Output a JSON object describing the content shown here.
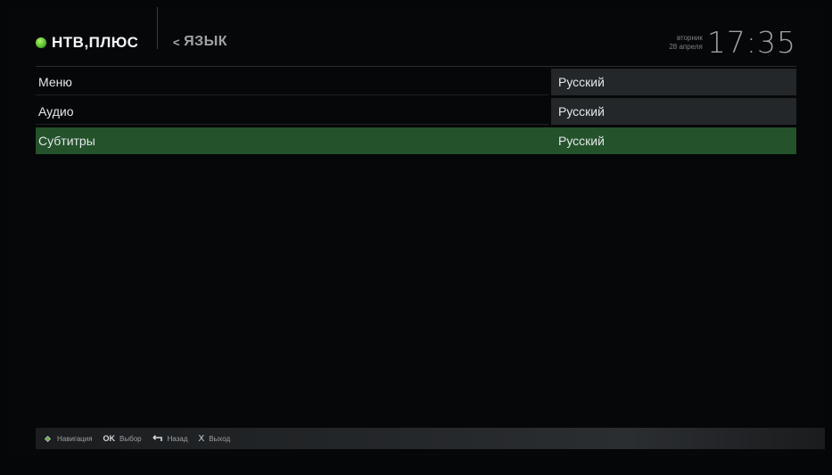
{
  "header": {
    "logo_text": "НТВ,ПЛЮС",
    "page_title": "ЯЗЫК",
    "back_glyph": "<",
    "day_of_week": "вторник",
    "date": "28 апреля",
    "time": "17:35"
  },
  "settings": [
    {
      "label": "Меню",
      "value": "Русский",
      "selected": false
    },
    {
      "label": "Аудио",
      "value": "Русский",
      "selected": false
    },
    {
      "label": "Субтитры",
      "value": "Русский",
      "selected": true
    }
  ],
  "footer": {
    "hints": [
      {
        "icon": "navigation-icon",
        "label": "Навигация"
      },
      {
        "icon": "ok-key-icon",
        "key": "OK",
        "label": "Выбор"
      },
      {
        "icon": "back-arrow-icon",
        "label": "Назад"
      },
      {
        "icon": "exit-x-icon",
        "key": "X",
        "label": "Выход"
      }
    ]
  },
  "colors": {
    "background": "#060708",
    "selected_row": "#24522b",
    "value_cell": "#23272a",
    "logo_accent": "#59c22e"
  }
}
